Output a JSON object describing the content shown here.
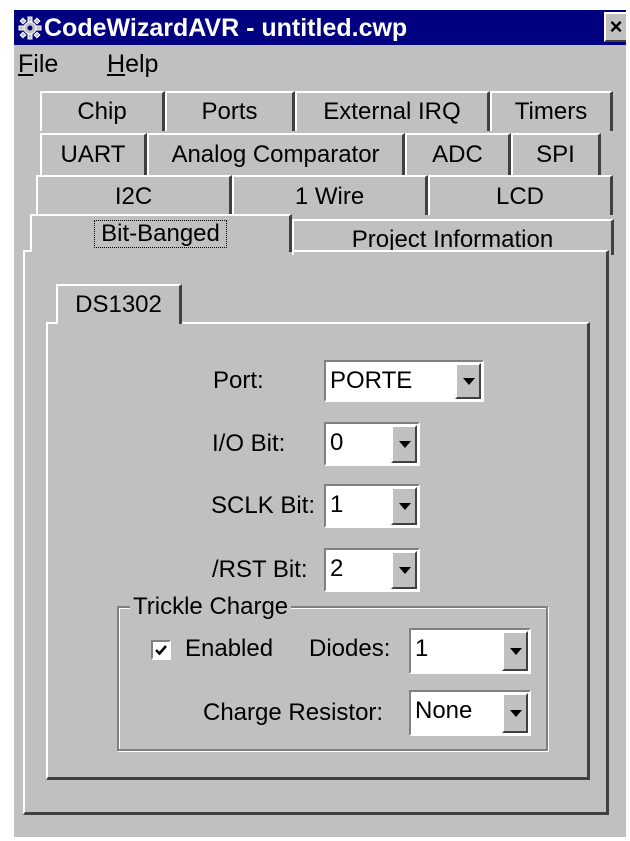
{
  "window": {
    "title": "CodeWizardAVR - untitled.cwp",
    "close_glyph": "×"
  },
  "menu": [
    {
      "label": "File",
      "mnemonic": "F",
      "rest": "ile"
    },
    {
      "label": "Help",
      "mnemonic": "H",
      "rest": "elp"
    }
  ],
  "tabs": {
    "row1": [
      "Chip",
      "Ports",
      "External IRQ",
      "Timers"
    ],
    "row2": [
      "UART",
      "Analog Comparator",
      "ADC",
      "SPI"
    ],
    "row3": [
      "I2C",
      "1 Wire",
      "LCD"
    ],
    "row4": [
      "Bit-Banged",
      "Project Information"
    ],
    "active": "Bit-Banged"
  },
  "inner_tab": {
    "label": "DS1302"
  },
  "ds1302": {
    "port_label": "Port:",
    "port_value": "PORTE",
    "io_label": "I/O Bit:",
    "io_value": "0",
    "sclk_label": "SCLK Bit:",
    "sclk_value": "1",
    "rst_label": "/RST Bit:",
    "rst_value": "2"
  },
  "trickle": {
    "title": "Trickle Charge",
    "enabled_label": "Enabled",
    "enabled_checked": true,
    "diodes_label": "Diodes:",
    "diodes_value": "1",
    "resistor_label": "Charge Resistor:",
    "resistor_value": "None"
  },
  "colors": {
    "titlebar": "#000080",
    "face": "#c0c0c0"
  }
}
